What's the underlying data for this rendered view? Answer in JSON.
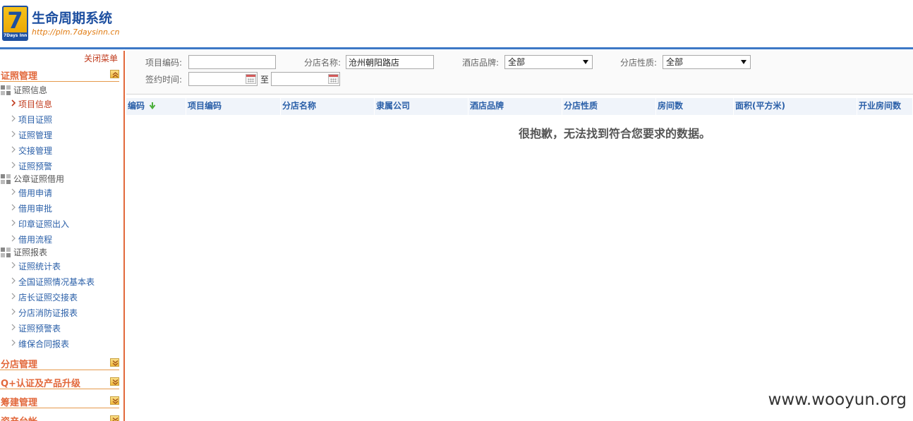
{
  "header": {
    "logo_number": "7",
    "logo_text": "7Days Inn",
    "title": "生命周期系统",
    "url": "http://plm.7daysinn.cn"
  },
  "sidebar": {
    "close_menu": "关闭菜单",
    "sections": [
      {
        "label": "证照管理",
        "expanded": true,
        "groups": [
          {
            "label": "证照信息",
            "items": [
              "项目信息",
              "项目证照",
              "证照管理",
              "交接管理",
              "证照预警"
            ]
          },
          {
            "label": "公章证照借用",
            "items": [
              "借用申请",
              "借用审批",
              "印章证照出入",
              "借用流程"
            ]
          },
          {
            "label": "证照报表",
            "items": [
              "证照统计表",
              "全国证照情况基本表",
              "店长证照交接表",
              "分店消防证报表",
              "证照预警表",
              "维保合同报表"
            ]
          }
        ]
      },
      {
        "label": "分店管理",
        "expanded": false
      },
      {
        "label": "Q+认证及产品升级",
        "expanded": false
      },
      {
        "label": "筹建管理",
        "expanded": false
      },
      {
        "label": "资产台帐",
        "expanded": false
      }
    ],
    "active_item": "项目信息"
  },
  "filters": {
    "project_code_label": "项目编码:",
    "project_code_value": "",
    "branch_name_label": "分店名称:",
    "branch_name_value": "沧州朝阳路店",
    "hotel_brand_label": "酒店品牌:",
    "hotel_brand_value": "全部",
    "branch_type_label": "分店性质:",
    "branch_type_value": "全部",
    "sign_time_label": "签约时间:",
    "sign_time_from": "",
    "to_label": "至",
    "sign_time_to": ""
  },
  "table": {
    "columns": [
      "编码",
      "项目编码",
      "分店名称",
      "隶属公司",
      "酒店品牌",
      "分店性质",
      "房间数",
      "面积(平方米)",
      "开业房间数"
    ],
    "empty_message": "很抱歉，无法找到符合您要求的数据。"
  },
  "watermark": "www.wooyun.org",
  "colors": {
    "brand_blue": "#1d4fa0",
    "accent_orange": "#e2683b",
    "link_blue": "#2a5fa8",
    "active_red": "#c03a1c"
  }
}
